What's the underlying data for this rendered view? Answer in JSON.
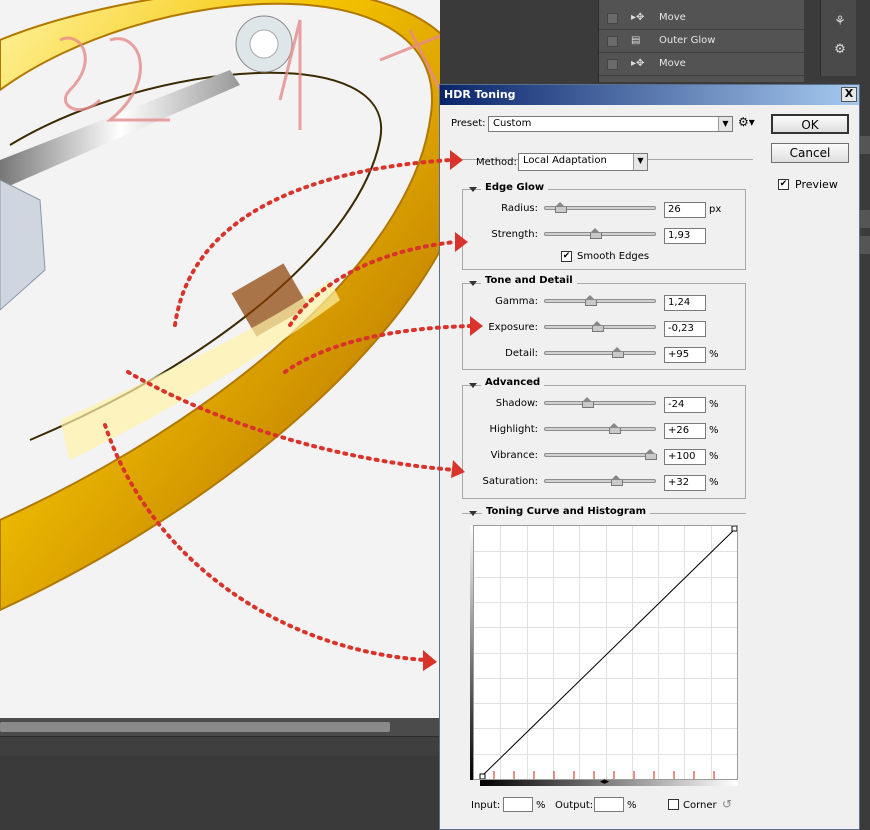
{
  "layers_panel": {
    "items": [
      {
        "label": "Move",
        "icon": "move-icon"
      },
      {
        "label": "Outer Glow",
        "icon": "document-icon"
      },
      {
        "label": "Move",
        "icon": "move-icon"
      }
    ]
  },
  "canvas_handwriting": "32 bit",
  "dialog": {
    "title": "HDR Toning",
    "close_label": "X",
    "preset_label": "Preset:",
    "preset_value": "Custom",
    "ok_label": "OK",
    "cancel_label": "Cancel",
    "preview_label": "Preview",
    "preview_checked": true,
    "method_label": "Method:",
    "method_value": "Local Adaptation",
    "edge_glow": {
      "title": "Edge Glow",
      "radius_label": "Radius:",
      "radius_value": "26",
      "radius_unit": "px",
      "radius_pos": 0.1,
      "strength_label": "Strength:",
      "strength_value": "1,93",
      "strength_pos": 0.45,
      "smooth_edges_label": "Smooth Edges",
      "smooth_edges_checked": true
    },
    "tone_detail": {
      "title": "Tone and Detail",
      "gamma_label": "Gamma:",
      "gamma_value": "1,24",
      "gamma_pos": 0.4,
      "exposure_label": "Exposure:",
      "exposure_value": "-0,23",
      "exposure_pos": 0.47,
      "detail_label": "Detail:",
      "detail_value": "+95",
      "detail_unit": "%",
      "detail_pos": 0.67
    },
    "advanced": {
      "title": "Advanced",
      "shadow_label": "Shadow:",
      "shadow_value": "-24",
      "shadow_unit": "%",
      "shadow_pos": 0.37,
      "highlight_label": "Highlight:",
      "highlight_value": "+26",
      "highlight_unit": "%",
      "highlight_pos": 0.64,
      "vibrance_label": "Vibrance:",
      "vibrance_value": "+100",
      "vibrance_unit": "%",
      "vibrance_pos": 1.0,
      "saturation_label": "Saturation:",
      "saturation_value": "+32",
      "saturation_unit": "%",
      "saturation_pos": 0.66
    },
    "curve": {
      "title": "Toning Curve and Histogram",
      "input_label": "Input:",
      "input_unit": "%",
      "output_label": "Output:",
      "output_unit": "%",
      "corner_label": "Corner",
      "corner_checked": false
    }
  },
  "colors": {
    "title_start": "#0a246a",
    "title_end": "#a6caf0",
    "annotation_red": "#d9342b",
    "gold": "#f0b800"
  }
}
